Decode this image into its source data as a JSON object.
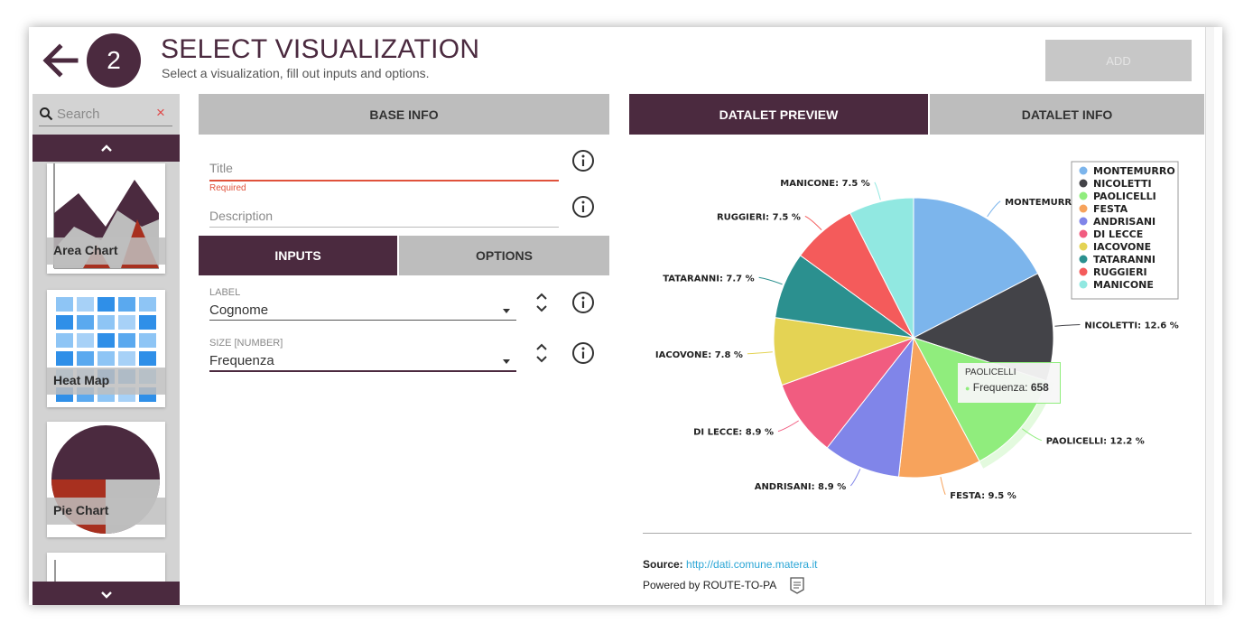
{
  "header": {
    "step_number": "2",
    "title": "SELECT VISUALIZATION",
    "subtitle": "Select a visualization, fill out inputs and options.",
    "add_label": "ADD"
  },
  "sidebar": {
    "search_placeholder": "Search",
    "clear_symbol": "×",
    "items": [
      {
        "label": "Area Chart",
        "icon": "area-chart-thumbnail"
      },
      {
        "label": "Heat Map",
        "icon": "heat-map-thumbnail"
      },
      {
        "label": "Pie Chart",
        "icon": "pie-chart-thumbnail"
      }
    ]
  },
  "base_info": {
    "header": "BASE INFO",
    "title_placeholder": "Title",
    "title_error": "Required",
    "description_placeholder": "Description"
  },
  "config_tabs": {
    "inputs": "INPUTS",
    "options": "OPTIONS"
  },
  "inputs": [
    {
      "label": "LABEL",
      "value": "Cognome"
    },
    {
      "label": "SIZE [NUMBER]",
      "value": "Frequenza"
    }
  ],
  "preview_tabs": {
    "preview": "DATALET PREVIEW",
    "info": "DATALET INFO"
  },
  "tooltip": {
    "title": "PAOLICELLI",
    "series": "Frequenza",
    "value": "658"
  },
  "footer": {
    "source_label": "Source:",
    "source_url": "http://dati.comune.matera.it",
    "powered_by": "Powered by ROUTE-TO-PA"
  },
  "colors": {
    "brand": "#4b2a3f",
    "error": "#e0523b",
    "link": "#2ba6d6"
  },
  "chart_data": {
    "type": "pie",
    "categories": [
      "MONTEMURRO",
      "NICOLETTI",
      "PAOLICELLI",
      "FESTA",
      "ANDRISANI",
      "DI LECCE",
      "IACOVONE",
      "TATARANNI",
      "RUGGIERI",
      "MANICONE"
    ],
    "values": [
      17.4,
      12.6,
      12.2,
      9.5,
      8.9,
      8.9,
      7.8,
      7.7,
      7.5,
      7.5
    ],
    "data_labels": [
      "MONTEMURRO",
      "NICOLETTI: 12.6 %",
      "PAOLICELLI: 12.2 %",
      "FESTA: 9.5 %",
      "ANDRISANI: 8.9 %",
      "DI LECCE: 8.9 %",
      "IACOVONE: 7.8 %",
      "TATARANNI: 7.7 %",
      "RUGGIERI: 7.5 %",
      "MANICONE: 7.5 %"
    ],
    "colors": [
      "#7cb5ec",
      "#434348",
      "#90ed7d",
      "#f7a35c",
      "#8085e9",
      "#f15c80",
      "#e4d354",
      "#2b908f",
      "#f45b5b",
      "#91e8e1"
    ],
    "legend_position": "top-right"
  }
}
